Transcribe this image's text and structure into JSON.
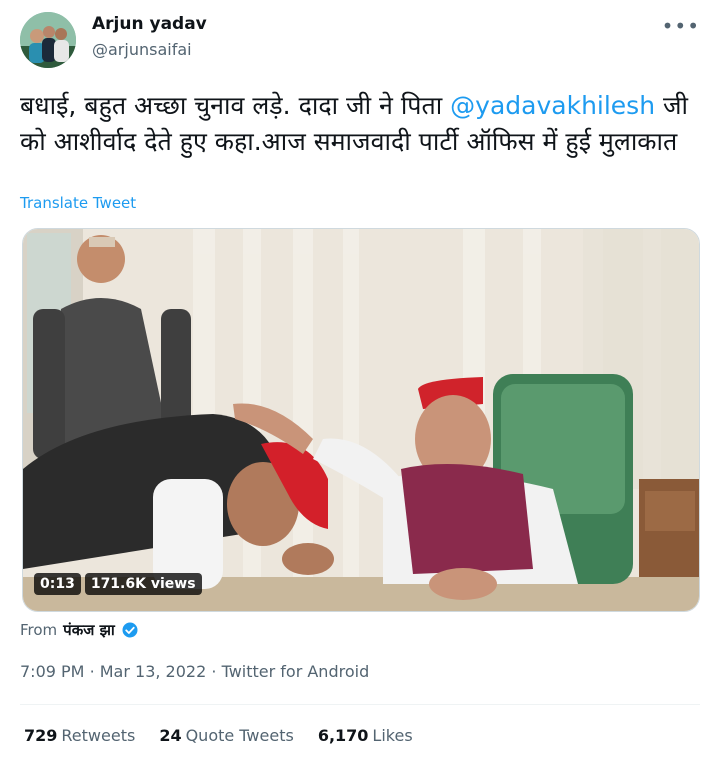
{
  "author": {
    "name": "Arjun yadav",
    "handle": "@arjunsaifai",
    "avatar_icon": "group-photo-avatar"
  },
  "more_icon": "more-horizontal-icon",
  "tweet": {
    "text_before": "बधाई, बहुत अच्छा चुनाव लड़े. दादा जी ने पिता ",
    "mention": "@yadavakhilesh",
    "text_after": " जी को आशीर्वाद देते हुए कहा.आज समाजवादी पार्टी ऑफिस में हुई मुलाकात",
    "translate_label": "Translate Tweet"
  },
  "video": {
    "duration": "0:13",
    "views": "171.6K views"
  },
  "attribution": {
    "from_label": "From",
    "from_name": "पंकज झा",
    "verified_icon": "verified-badge-icon"
  },
  "meta": {
    "time": "7:09 PM",
    "date": "Mar 13, 2022",
    "source": "Twitter for Android",
    "sep": "·"
  },
  "stats": {
    "retweets_count": "729",
    "retweets_label": "Retweets",
    "quotes_count": "24",
    "quotes_label": "Quote Tweets",
    "likes_count": "6,170",
    "likes_label": "Likes"
  },
  "colors": {
    "link": "#1d9bf0",
    "secondary_text": "#536471",
    "primary_text": "#0f1419"
  }
}
